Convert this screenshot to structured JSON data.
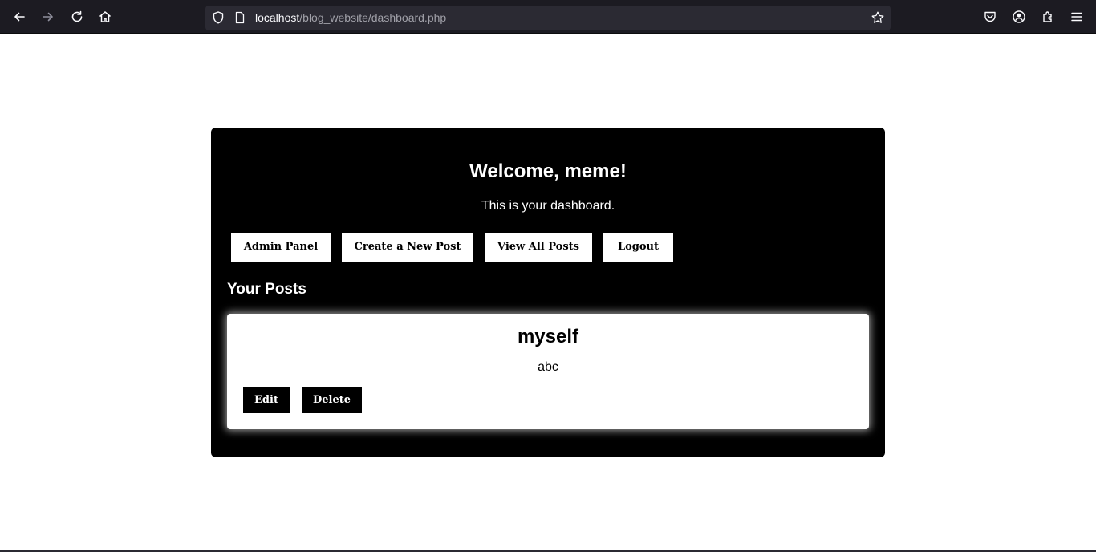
{
  "browser": {
    "url_host": "localhost",
    "url_path": "/blog_website/dashboard.php",
    "icons": [
      "back-icon",
      "forward-icon",
      "reload-icon",
      "home-icon",
      "shield-icon",
      "page-icon",
      "bookmark-star-icon",
      "pocket-icon",
      "account-icon",
      "extensions-icon",
      "menu-icon"
    ]
  },
  "dashboard": {
    "welcome": "Welcome, meme!",
    "subtitle": "This is your dashboard.",
    "buttons": {
      "admin_panel": "Admin Panel",
      "create_post": "Create a New Post",
      "view_posts": "View All Posts",
      "logout": "Logout"
    },
    "section_title": "Your Posts",
    "posts": [
      {
        "title": "myself",
        "body": "abc",
        "edit_label": "Edit",
        "delete_label": "Delete"
      }
    ]
  },
  "colors": {
    "browser_chrome": "#1c1b22",
    "url_field": "#2b2a33",
    "panel": "#000000",
    "card": "#ffffff"
  }
}
